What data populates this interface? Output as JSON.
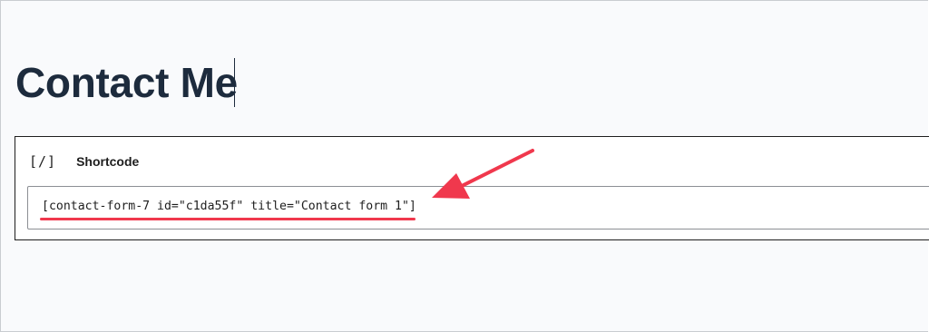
{
  "page": {
    "title": "Contact Me"
  },
  "block": {
    "icon": "[/]",
    "icon_name": "shortcode-icon",
    "label": "Shortcode",
    "shortcode_value": "[contact-form-7 id=\"c1da55f\" title=\"Contact form 1\"]"
  },
  "annotation": {
    "color": "#f0384d",
    "arrow_icon": "arrow-icon"
  }
}
